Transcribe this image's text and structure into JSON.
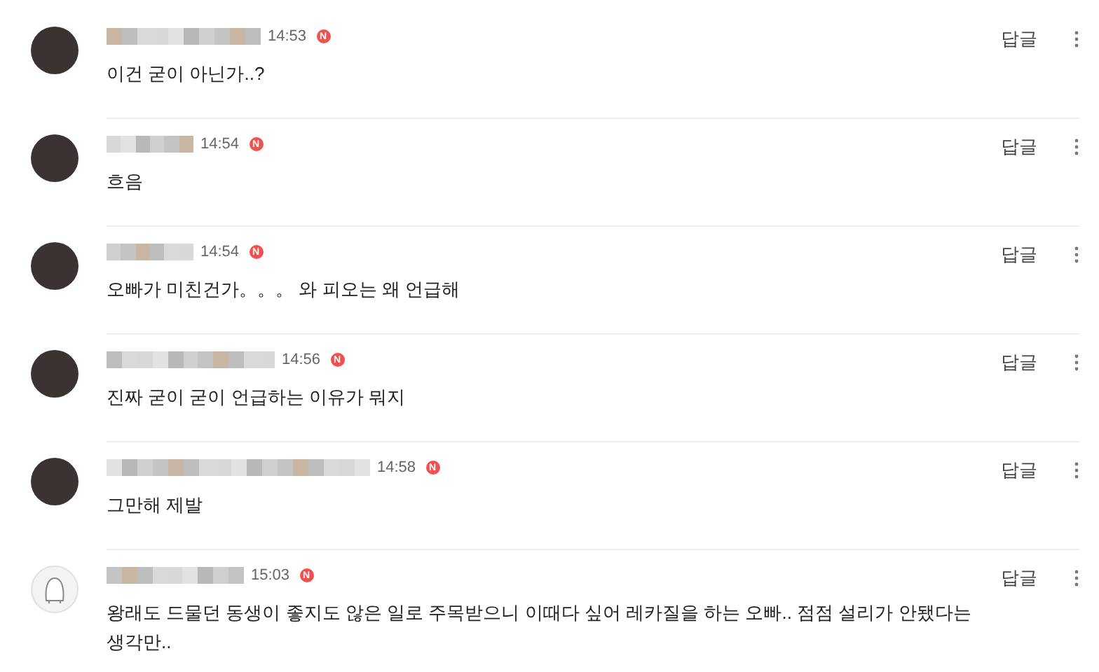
{
  "comments": [
    {
      "kind": "photo",
      "time": "14:53",
      "new_badge": "N",
      "text": "이건 굳이 아닌가..?",
      "reply": "답글"
    },
    {
      "kind": "photo",
      "time": "14:54",
      "new_badge": "N",
      "text": "흐음",
      "reply": "답글"
    },
    {
      "kind": "photo",
      "time": "14:54",
      "new_badge": "N",
      "text": "오빠가 미친건가。。。 와 피오는 왜 언급해",
      "reply": "답글"
    },
    {
      "kind": "photo",
      "time": "14:56",
      "new_badge": "N",
      "text": "진짜 굳이 굳이 언급하는 이유가 뭐지",
      "reply": "답글"
    },
    {
      "kind": "photo",
      "time": "14:58",
      "new_badge": "N",
      "text": "그만해 제발",
      "reply": "답글"
    },
    {
      "kind": "default",
      "time": "15:03",
      "new_badge": "N",
      "text": "왕래도 드물던 동생이 좋지도 않은 일로 주목받으니 이때다 싶어 레카질을 하는 오빠.. 점점 설리가 안됐다는 생각만..",
      "reply": "답글"
    }
  ]
}
